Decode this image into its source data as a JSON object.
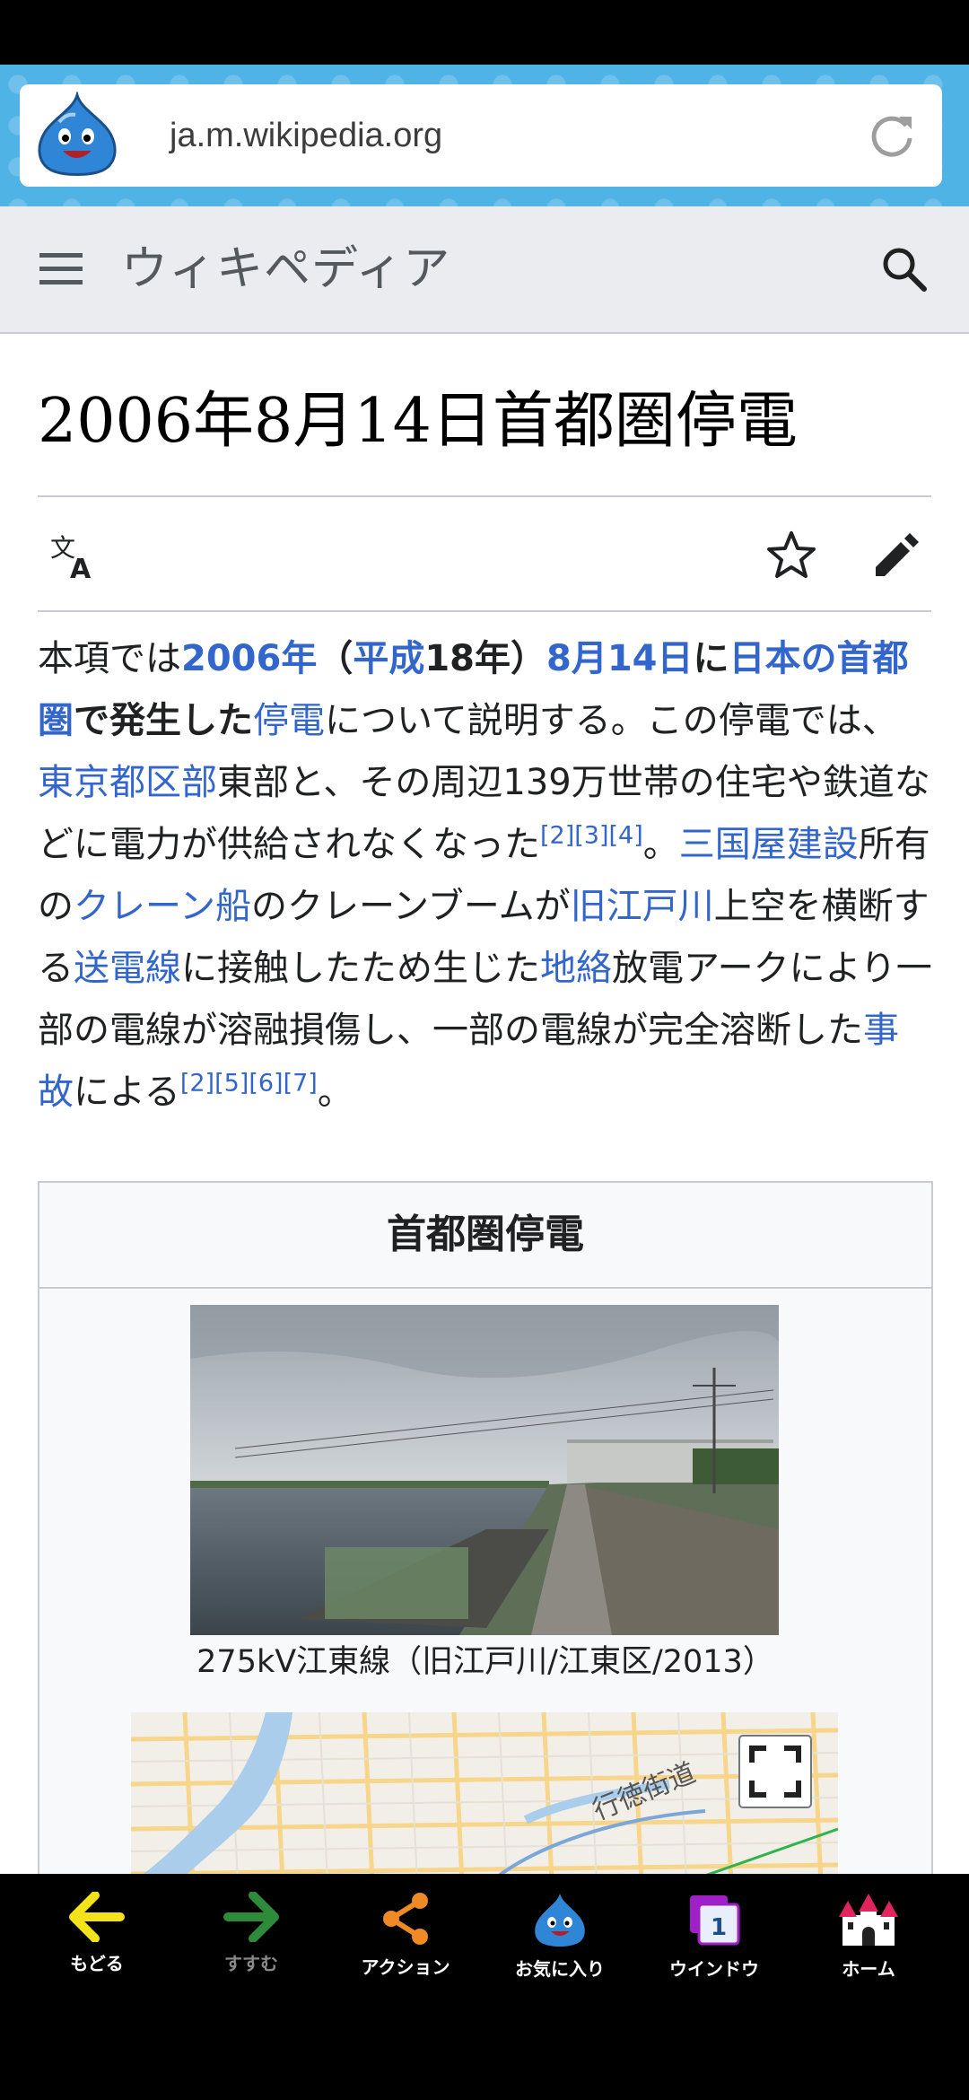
{
  "browser": {
    "url": "ja.m.wikipedia.org"
  },
  "wiki": {
    "wordmark": "ウィキペディア",
    "title": "2006年8月14日首都圏停電"
  },
  "article": {
    "p": {
      "s01": "本項では",
      "l01": "2006年",
      "s02": "（",
      "l02": "平成",
      "s03": "18年",
      "s04": "）",
      "l03": "8月14日",
      "s05": "に",
      "l04": "日本の首都圏",
      "s06": "で",
      "s07": "発生した",
      "l05": "停電",
      "s08": "について説明する。この停電では、",
      "l06": "東京都区部",
      "s09": "東部と、その周辺139万世帯の住宅や鉄道などに電力が供給されなくなった",
      "r01": "[2]",
      "r02": "[3]",
      "r03": "[4]",
      "s10": "。",
      "l07": "三国屋建設",
      "s11": "所有の",
      "l08": "クレーン船",
      "s12": "のクレーンブームが",
      "l09": "旧江戸川",
      "s13": "上空を横断する",
      "l10": "送電線",
      "s14": "に接触したため生じた",
      "l11": "地絡",
      "s15": "放電アークにより一部の電線が溶融損傷し、一部の電線が完全溶断した",
      "l12": "事故",
      "s16": "による",
      "r04": "[2]",
      "r05": "[5]",
      "r06": "[6]",
      "r07": "[7]",
      "s17": "。"
    }
  },
  "infobox": {
    "title": "首都圏停電",
    "caption": "275kV江東線（旧江戸川/江東区/2013）",
    "map_road_label": "行徳街道"
  },
  "bottom_nav": {
    "back": "もどる",
    "forward": "すすむ",
    "action": "アクション",
    "favorites": "お気に入り",
    "window": "ウインドウ",
    "window_count": "1",
    "home": "ホーム"
  },
  "colors": {
    "link": "#3366cc",
    "url_band": "#4fb3e6",
    "wiki_header": "#eaecf0",
    "back_arrow": "#f4e21a",
    "forward_arrow": "#2e8b3a",
    "share": "#f08a24"
  }
}
